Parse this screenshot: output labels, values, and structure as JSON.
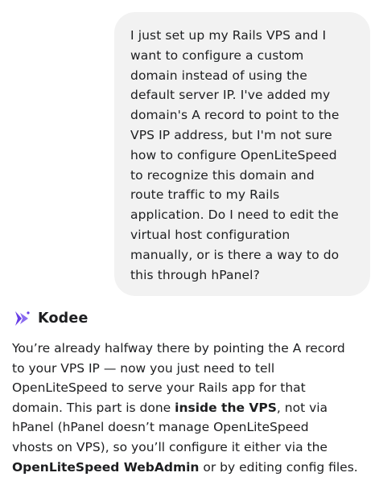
{
  "user_message": {
    "text": "I just set up my Rails VPS and I\nwant to configure a custom\ndomain instead of using the\ndefault server IP. I've added my\ndomain's A record to point to the\nVPS IP address, but I'm not sure\nhow to configure OpenLiteSpeed\nto recognize this domain and\nroute traffic to my Rails\napplication. Do I need to edit the\nvirtual host configuration\nmanually, or is there a way to do\nthis through hPanel?"
  },
  "assistant": {
    "name": "Kodee",
    "icon": "kodee-logo-icon",
    "accent_color": "#673de6",
    "line1": "You’re already halfway there by pointing the A record",
    "line2": "to your VPS IP — now you just need to tell",
    "line3": "OpenLiteSpeed to serve your Rails app for that",
    "line4_pre": "domain. This part is done ",
    "line4_bold": "inside the VPS",
    "line4_post": ", not via",
    "line5": "hPanel (hPanel doesn’t manage OpenLiteSpeed",
    "line6": "vhosts on VPS), so you’ll configure it either via the",
    "line7_bold": "OpenLiteSpeed WebAdmin",
    "line7_post": " or by editing config files."
  }
}
